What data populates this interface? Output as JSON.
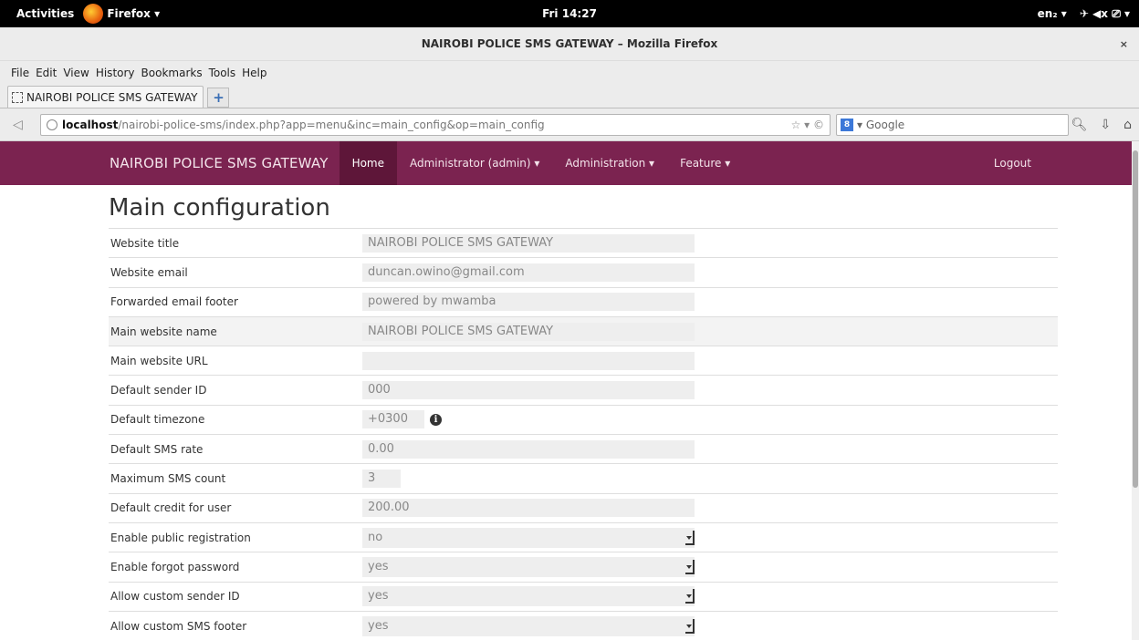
{
  "topbar": {
    "activities": "Activities",
    "app_name": "Firefox ▾",
    "clock": "Fri 14:27",
    "keyboard": "en₂ ▾",
    "status_icons": "✈ ◀ⅹ ⎚ ▾"
  },
  "window": {
    "title": "NAIROBI POLICE SMS GATEWAY – Mozilla Firefox",
    "close": "×"
  },
  "menu": [
    "File",
    "Edit",
    "View",
    "History",
    "Bookmarks",
    "Tools",
    "Help"
  ],
  "tab": {
    "title": "NAIROBI POLICE SMS GATEWAY",
    "new_tab": "+"
  },
  "urlbar": {
    "host": "localhost",
    "path": "/nairobi-police-sms/index.php?app=menu&inc=main_config&op=main_config",
    "icons": "☆ ▾ ©"
  },
  "search": {
    "engine_label": "8",
    "placeholder": "▾ Google"
  },
  "site": {
    "brand": "NAIROBI POLICE SMS GATEWAY",
    "nav": [
      "Home",
      "Administrator (admin) ▾",
      "Administration ▾",
      "Feature ▾"
    ],
    "logout": "Logout"
  },
  "page": {
    "title": "Main configuration",
    "rows": [
      {
        "label": "Website title",
        "value": "NAIROBI POLICE SMS GATEWAY"
      },
      {
        "label": "Website email",
        "value": "duncan.owino@gmail.com"
      },
      {
        "label": "Forwarded email footer",
        "value": "powered by mwamba"
      },
      {
        "label": "Main website name",
        "value": "NAIROBI POLICE SMS GATEWAY"
      },
      {
        "label": "Main website URL",
        "value": ""
      },
      {
        "label": "Default sender ID",
        "value": "000"
      },
      {
        "label": "Default timezone",
        "value": "+0300"
      },
      {
        "label": "Default SMS rate",
        "value": "0.00"
      },
      {
        "label": "Maximum SMS count",
        "value": "3"
      },
      {
        "label": "Default credit for user",
        "value": "200.00"
      },
      {
        "label": "Enable public registration",
        "value": "no"
      },
      {
        "label": "Enable forgot password",
        "value": "yes"
      },
      {
        "label": "Allow custom sender ID",
        "value": "yes"
      },
      {
        "label": "Allow custom SMS footer",
        "value": "yes"
      }
    ]
  }
}
